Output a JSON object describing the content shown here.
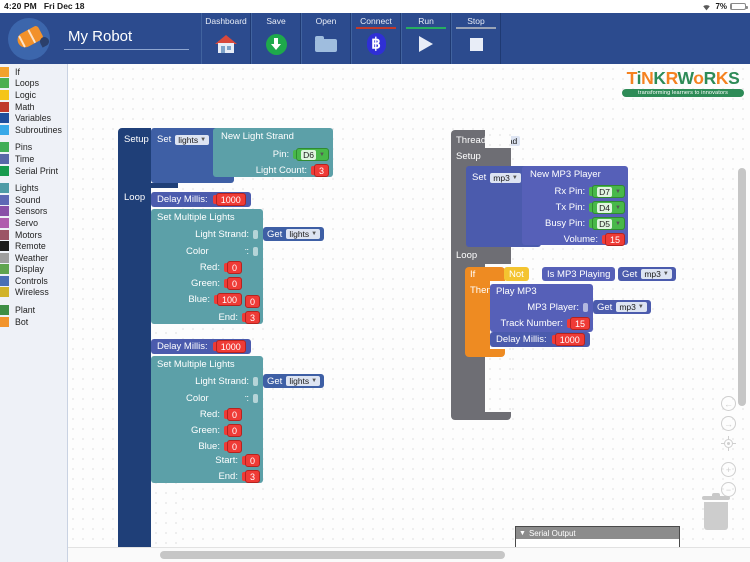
{
  "statusbar": {
    "time": "4:20 PM",
    "date": "Fri Dec 18",
    "battery_pct": "7%",
    "wifi_icon": "wifi-icon"
  },
  "header": {
    "project_name": "My Robot",
    "logo_icon": "robot-rocket-icon",
    "toolbar": [
      {
        "label": "Dashboard",
        "icon": "house-icon",
        "underline": "transparent"
      },
      {
        "label": "Save",
        "icon": "download-arrow-icon",
        "underline": "transparent"
      },
      {
        "label": "Open",
        "icon": "folder-icon",
        "underline": "transparent"
      },
      {
        "label": "Connect",
        "icon": "bluetooth-icon",
        "underline": "#C0392B"
      },
      {
        "label": "Run",
        "icon": "play-icon",
        "underline": "#27AE60"
      },
      {
        "label": "Stop",
        "icon": "stop-icon",
        "underline": "#9AA4B6"
      }
    ]
  },
  "sidebar": {
    "groups": [
      [
        {
          "label": "If",
          "color": "#F2A22C"
        },
        {
          "label": "Loops",
          "color": "#4CAF50"
        },
        {
          "label": "Logic",
          "color": "#F5C518"
        },
        {
          "label": "Math",
          "color": "#C0392B"
        },
        {
          "label": "Variables",
          "color": "#1F4E9C"
        },
        {
          "label": "Subroutines",
          "color": "#38A9E8"
        }
      ],
      [
        {
          "label": "Pins",
          "color": "#3FAE57"
        },
        {
          "label": "Time",
          "color": "#5868A8"
        },
        {
          "label": "Serial Print",
          "color": "#179B4E"
        }
      ],
      [
        {
          "label": "Lights",
          "color": "#4E9BA6"
        },
        {
          "label": "Sound",
          "color": "#5E68B5"
        },
        {
          "label": "Sensors",
          "color": "#8A4FA8"
        },
        {
          "label": "Servo",
          "color": "#B05BAE"
        },
        {
          "label": "Motors",
          "color": "#9C5566"
        },
        {
          "label": "Remote",
          "color": "#1B1B1B"
        },
        {
          "label": "Weather",
          "color": "#9E9E9E"
        },
        {
          "label": "Display",
          "color": "#5FA44E"
        },
        {
          "label": "Controls",
          "color": "#4A6FB5"
        },
        {
          "label": "Wireless",
          "color": "#D1B32A"
        }
      ],
      [
        {
          "label": "Plant",
          "color": "#3E8E45"
        },
        {
          "label": "Bot",
          "color": "#F2942C"
        }
      ]
    ]
  },
  "canvas": {
    "brand": {
      "word": "TiNKRWoRKS",
      "tagline": "transforming learners to innovators"
    },
    "main_program": {
      "setup_label": "Setup",
      "loop_label": "Loop",
      "set_label": "Set",
      "set_variable": "lights",
      "equals": "=",
      "new_light_strand": "New Light Strand",
      "pin_label": "Pin:",
      "pin_value": "D6",
      "light_count_label": "Light Count:",
      "light_count_value": "3",
      "delay_label": "Delay  Millis:",
      "delay_value_1": "1000",
      "set_multiple_lights_1": "Set Multiple Lights",
      "light_strand_label": "Light Strand:",
      "get_label": "Get",
      "get_variable": "lights",
      "color_label": "Color:",
      "color_block": "Color",
      "red_label": "Red:",
      "green_label": "Green:",
      "blue_label": "Blue:",
      "red_1": "0",
      "green_1": "0",
      "blue_1": "100",
      "start_label": "Start:",
      "end_label": "End:",
      "start_1": "0",
      "end_1": "3",
      "delay_value_2": "1000",
      "set_multiple_lights_2": "Set Multiple Lights",
      "red_2": "0",
      "green_2": "0",
      "blue_2": "0",
      "start_2": "0",
      "end_2": "3"
    },
    "thread_program": {
      "thread_label": "Thread",
      "thread_name": "thread",
      "setup_label": "Setup",
      "loop_label": "Loop",
      "set_label": "Set",
      "set_variable": "mp3",
      "equals": "=",
      "new_mp3_player": "New MP3 Player",
      "rx_pin_label": "Rx Pin:",
      "rx_pin_value": "D7",
      "tx_pin_label": "Tx Pin:",
      "tx_pin_value": "D4",
      "busy_pin_label": "Busy Pin:",
      "busy_pin_value": "D5",
      "volume_label": "Volume:",
      "volume_value": "15",
      "if_label": "If",
      "then_label": "Then",
      "not_label": "Not",
      "is_mp3_playing": "Is MP3 Playing",
      "get_label": "Get",
      "get_variable": "mp3",
      "play_mp3": "Play MP3",
      "mp3_player_label": "MP3 Player:",
      "track_number_label": "Track Number:",
      "track_number_value": "15",
      "delay_label": "Delay  Millis:",
      "delay_value": "1000"
    },
    "serial_output": {
      "title": "Serial Output",
      "triangle": "▼",
      "body": ""
    },
    "controls": [
      {
        "name": "undo-button",
        "glyph": "←"
      },
      {
        "name": "redo-button",
        "glyph": "→"
      },
      {
        "name": "center-view-button",
        "glyph": "target"
      },
      {
        "name": "zoom-in-button",
        "glyph": "+"
      },
      {
        "name": "zoom-out-button",
        "glyph": "−"
      }
    ],
    "trash_icon": "trash-icon"
  }
}
